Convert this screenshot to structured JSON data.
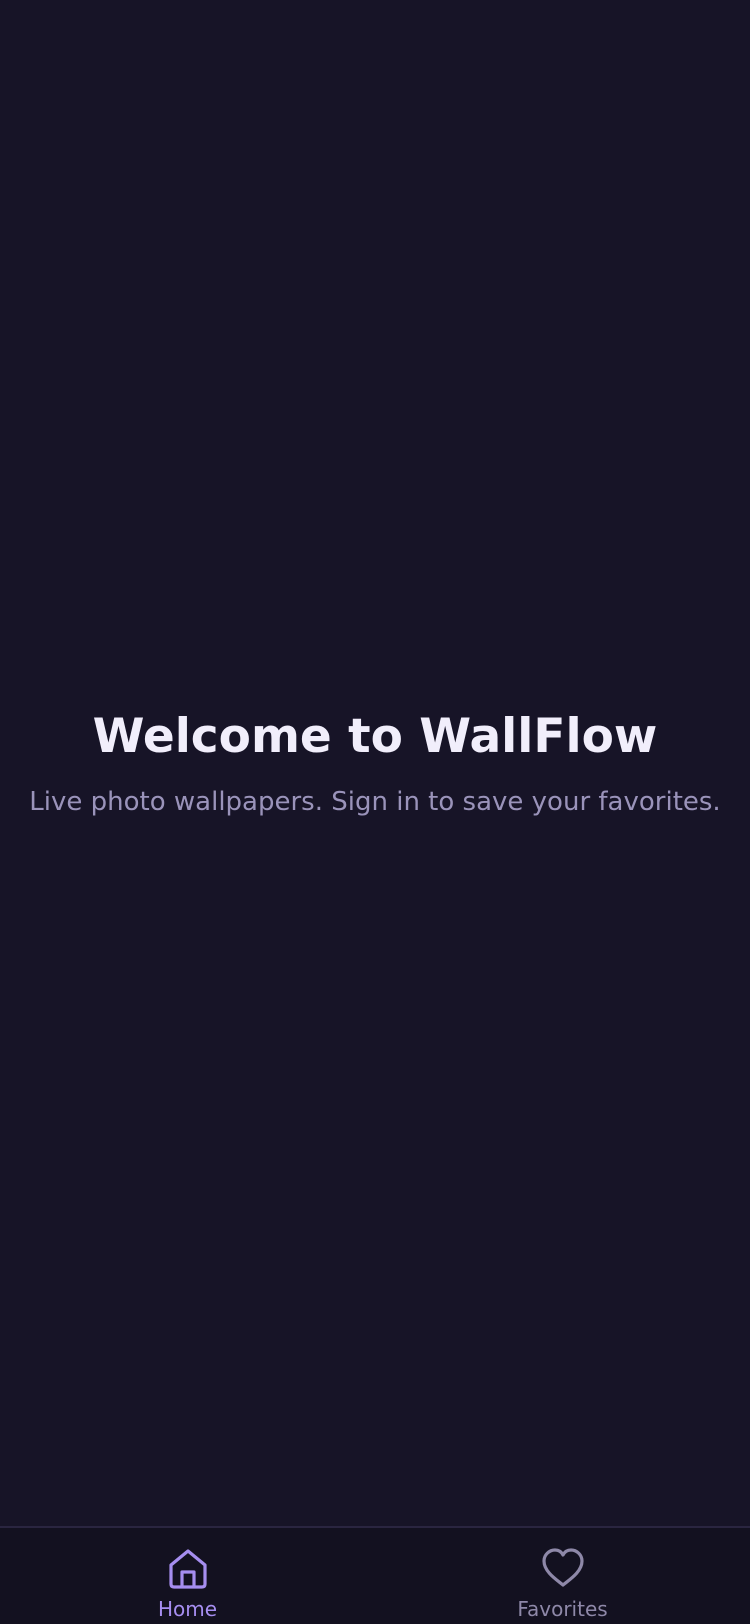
{
  "hero": {
    "title": "Welcome to WallFlow",
    "subtitle": "Live photo wallpapers. Sign in to save your favorites."
  },
  "tabbar": {
    "tabs": [
      {
        "label": "Home",
        "icon": "home-icon",
        "active": true
      },
      {
        "label": "Favorites",
        "icon": "heart-icon",
        "active": false
      }
    ]
  },
  "colors": {
    "background": "#171427",
    "tabbar_background": "#131120",
    "accent": "#a68ef0",
    "title": "#f1eefb",
    "subtitle": "#9a93ba",
    "inactive": "#8e88a8"
  }
}
